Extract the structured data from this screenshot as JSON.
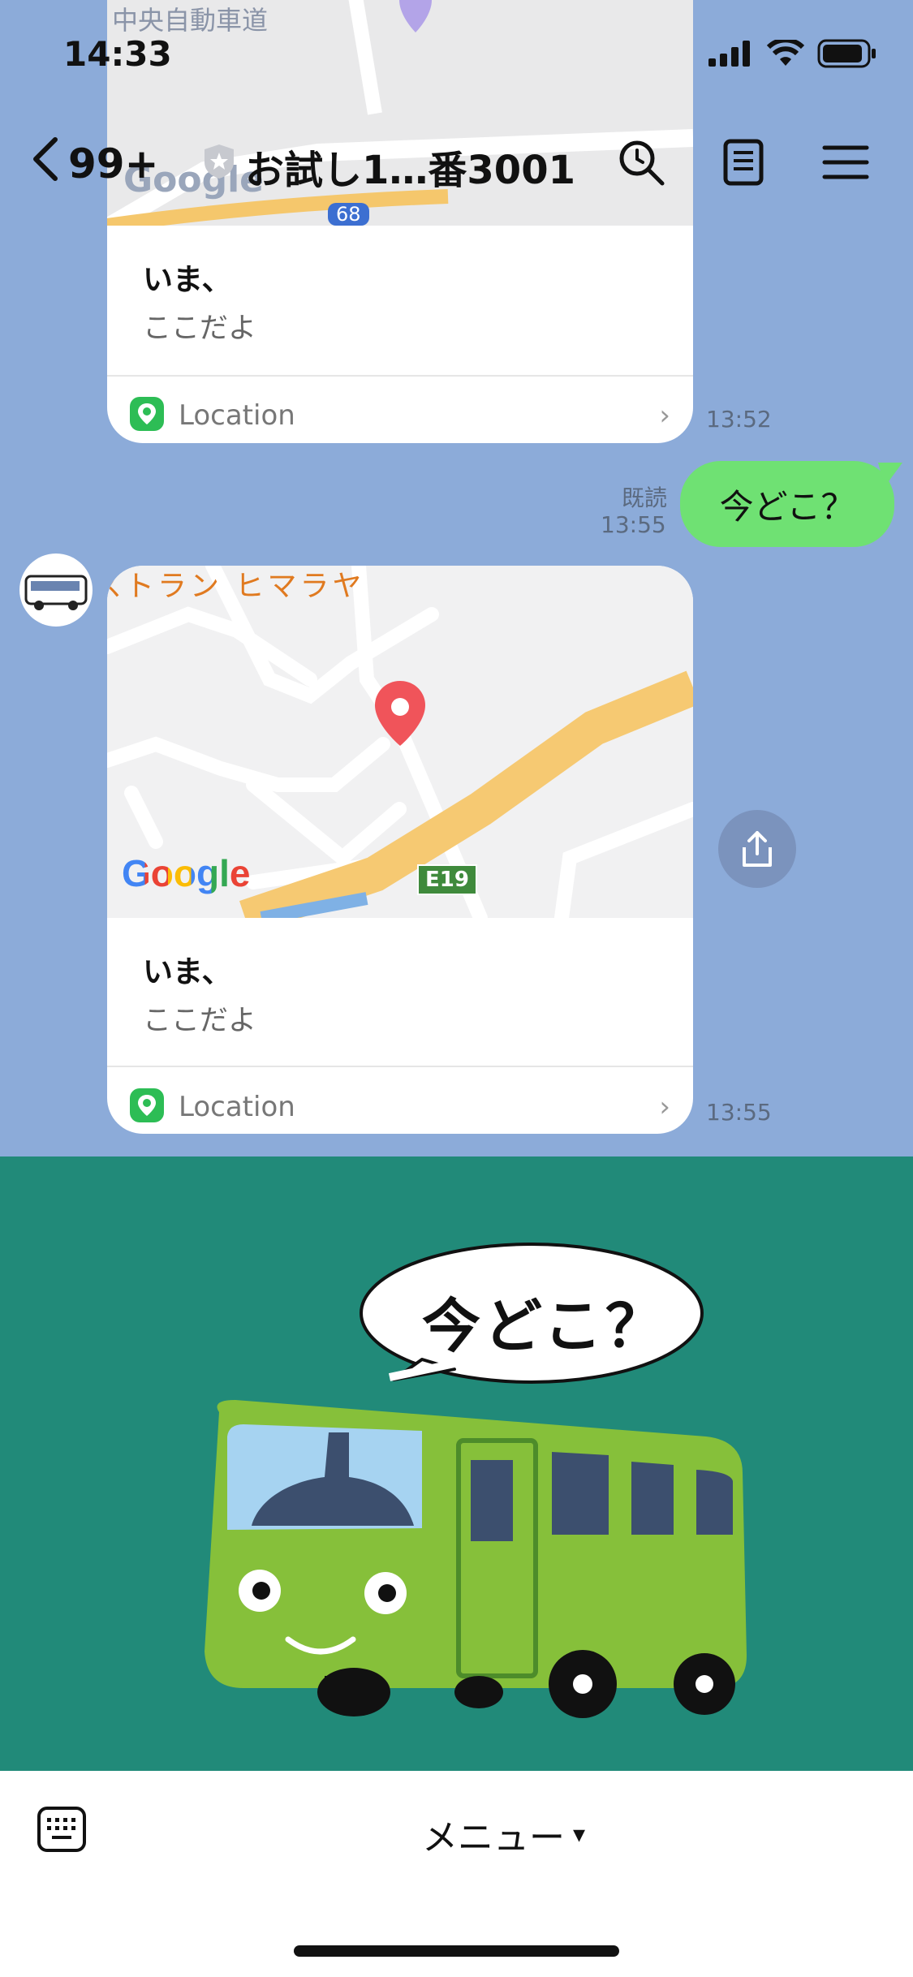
{
  "status": {
    "time": "14:33"
  },
  "header": {
    "back_count": "99+",
    "title": "お試し1…番3001"
  },
  "messages": [
    {
      "title": "いま、",
      "subtitle": "ここだよ",
      "footer_label": "Location",
      "time": "13:52"
    },
    {
      "text": "今どこ？",
      "read_label": "既読",
      "time": "13:55"
    },
    {
      "map_text": "ストラン ヒマラヤ",
      "map_road": "E19",
      "map_brand": "Google",
      "title": "いま、",
      "subtitle": "ここだよ",
      "footer_label": "Location",
      "time": "13:55"
    }
  ],
  "map_top": {
    "text": "中央自動車道",
    "road": "68",
    "brand": "Google"
  },
  "banner": {
    "speech": "今どこ？"
  },
  "menu": {
    "label": "メニュー",
    "arrow": "▾"
  },
  "colors": {
    "background": "#8cabd9",
    "bubble_me": "#6fe173",
    "banner": "#218a79",
    "map_pin": "#f0545a",
    "location_icon": "#2dbd55"
  }
}
